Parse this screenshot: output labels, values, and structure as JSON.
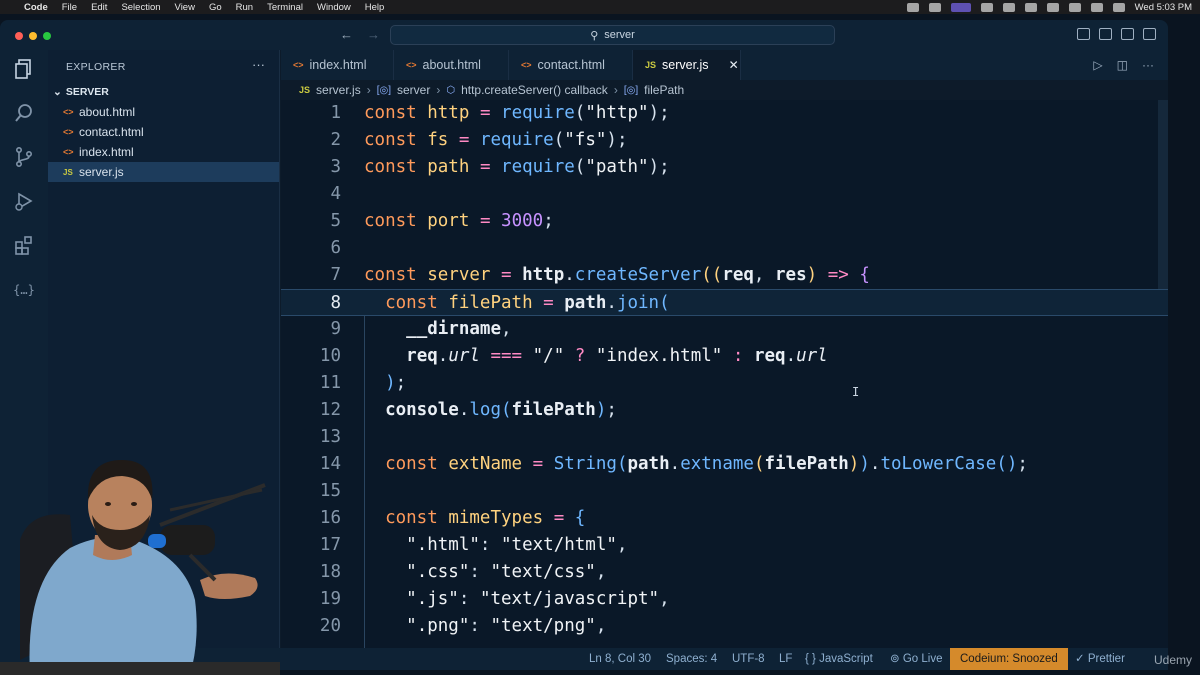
{
  "menubar": {
    "app": "Code",
    "items": [
      "File",
      "Edit",
      "Selection",
      "View",
      "Go",
      "Run",
      "Terminal",
      "Window",
      "Help"
    ],
    "clock": "Wed 5:03 PM"
  },
  "titlebar": {
    "search_text": "server"
  },
  "sidebar": {
    "title": "EXPLORER",
    "more": "···",
    "folder": "SERVER",
    "files": [
      {
        "name": "about.html",
        "type": "html"
      },
      {
        "name": "contact.html",
        "type": "html"
      },
      {
        "name": "index.html",
        "type": "html"
      },
      {
        "name": "server.js",
        "type": "js"
      }
    ]
  },
  "tabs": [
    {
      "label": "index.html",
      "icon": "<>"
    },
    {
      "label": "about.html",
      "icon": "<>"
    },
    {
      "label": "contact.html",
      "icon": "<>"
    },
    {
      "label": "server.js",
      "icon": "JS",
      "close": "✕"
    }
  ],
  "breadcrumb": {
    "file": "server.js",
    "file_icon": "JS",
    "item1": "server",
    "item2": "http.createServer() callback",
    "item3": "filePath"
  },
  "editor": {
    "line_numbers": [
      "1",
      "2",
      "3",
      "4",
      "5",
      "6",
      "7",
      "8",
      "9",
      "10",
      "11",
      "12",
      "13",
      "14",
      "15",
      "16",
      "17",
      "18",
      "19",
      "20"
    ],
    "current_line": 8
  },
  "statusbar": {
    "position": "Ln 8, Col 30",
    "spaces": "Spaces: 4",
    "encoding": "UTF-8",
    "eol": "LF",
    "language": "{ } JavaScript",
    "golive": "Go Live",
    "codeium": "Codeium: Snoozed",
    "prettier": "Prettier"
  },
  "watermark": "Udemy",
  "colors": {
    "keyword": "#ff9a5b",
    "variable": "#ffd27f",
    "operator": "#ff8ac4",
    "function": "#6fb7ff",
    "number": "#c792ff",
    "codeium_bg": "#d58a2b"
  }
}
